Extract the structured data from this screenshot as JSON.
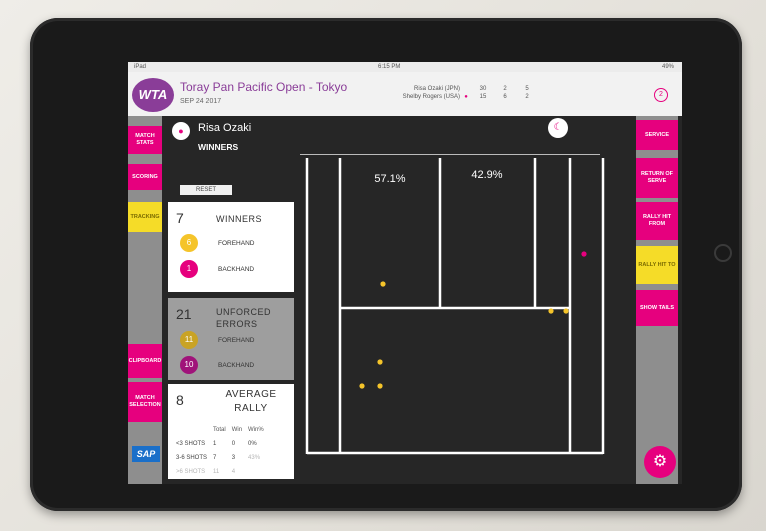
{
  "statusbar": {
    "device": "iPad",
    "time": "6:15 PM",
    "battery": "49%"
  },
  "header": {
    "logo": "WTA",
    "tournament": "Toray Pan Pacific Open - Tokyo",
    "date": "SEP 24 2017",
    "players": [
      {
        "name": "Risa Ozaki (JPN)",
        "serve": "",
        "scores": [
          "30",
          "2",
          "5"
        ]
      },
      {
        "name": "Shelby Rogers (USA)",
        "serve": "●",
        "scores": [
          "15",
          "6",
          "2"
        ]
      }
    ],
    "notification_count": "2"
  },
  "left_nav": {
    "match_stats": "MATCH STATS",
    "scoring": "SCORING",
    "tracking": "TRACKING",
    "clipboard": "CLIPBOARD",
    "match_selection": "MATCH SELECTION",
    "sponsor": "SAP"
  },
  "right_nav": {
    "service": "SERVICE",
    "return_of_serve": "RETURN OF SERVE",
    "rally_hit_from": "RALLY HIT FROM",
    "rally_hit_to": "RALLY HIT TO",
    "show_tails": "SHOW TAILS"
  },
  "player": {
    "name": "Risa Ozaki",
    "stat": "WINNERS"
  },
  "reset_label": "RESET",
  "winners": {
    "count": "7",
    "label": "WINNERS",
    "forehand": {
      "count": "6",
      "label": "FOREHAND",
      "color": "#f5c42a"
    },
    "backhand": {
      "count": "1",
      "label": "BACKHAND",
      "color": "#e6007e"
    }
  },
  "unforced": {
    "count": "21",
    "label": "UNFORCED ERRORS",
    "forehand": {
      "count": "11",
      "label": "FOREHAND",
      "color": "#c9a325"
    },
    "backhand": {
      "count": "10",
      "label": "BACKHAND",
      "color": "#a0137a"
    }
  },
  "rally": {
    "count": "8",
    "label": "AVERAGE RALLY",
    "columns": [
      "Total",
      "Win",
      "Win%"
    ],
    "rows": [
      {
        "label": "<3 SHOTS",
        "total": "1",
        "win": "0",
        "pct": "0%"
      },
      {
        "label": "3-6 SHOTS",
        "total": "7",
        "win": "3",
        "pct": "43%"
      },
      {
        "label": ">6 SHOTS",
        "total": "11",
        "win": "4",
        "pct": ""
      }
    ]
  },
  "court": {
    "left_pct": "57.1%",
    "right_pct": "42.9%",
    "points": [
      {
        "x": 0.26,
        "y": 0.42,
        "color": "#f5c42a"
      },
      {
        "x": 0.93,
        "y": 0.32,
        "color": "#e6007e"
      },
      {
        "x": 0.82,
        "y": 0.51,
        "color": "#f5c42a"
      },
      {
        "x": 0.87,
        "y": 0.51,
        "color": "#f5c42a"
      },
      {
        "x": 0.25,
        "y": 0.68,
        "color": "#f5c42a"
      },
      {
        "x": 0.19,
        "y": 0.76,
        "color": "#f5c42a"
      },
      {
        "x": 0.25,
        "y": 0.76,
        "color": "#f5c42a"
      }
    ]
  },
  "colors": {
    "accent": "#e6007e",
    "brand": "#8a3d98",
    "highlight": "#f5dc28"
  }
}
